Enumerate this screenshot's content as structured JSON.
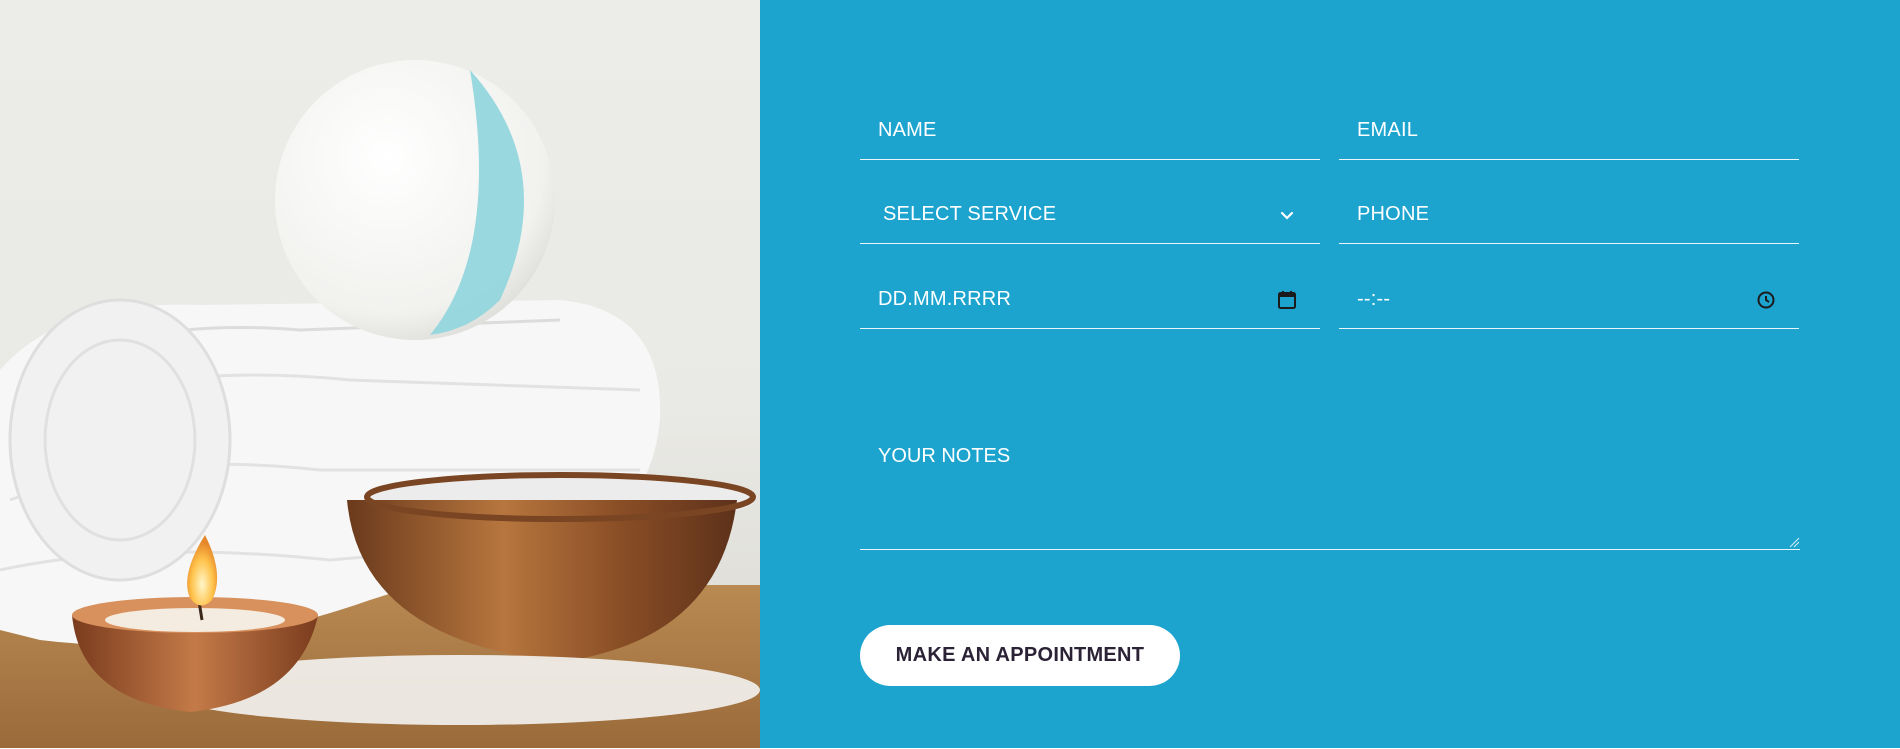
{
  "hero_image": {
    "alt_description": ""
  },
  "form": {
    "name_placeholder": "NAME",
    "email_placeholder": "EMAIL",
    "service_selected": "SELECT SERVICE",
    "phone_placeholder": "PHONE",
    "date_placeholder": "DD.MM.RRRR",
    "time_placeholder": "--:--",
    "notes_placeholder": "YOUR NOTES",
    "submit_label": "MAKE AN APPOINTMENT"
  },
  "icons": {
    "service": "chevron-down-icon",
    "date": "calendar-icon",
    "time": "clock-icon",
    "notes": "resize-grip-icon"
  },
  "colors": {
    "panel_bg": "#1ca4cf",
    "field_text": "#ffffff",
    "button_bg": "#ffffff",
    "button_text": "#2b2236"
  }
}
